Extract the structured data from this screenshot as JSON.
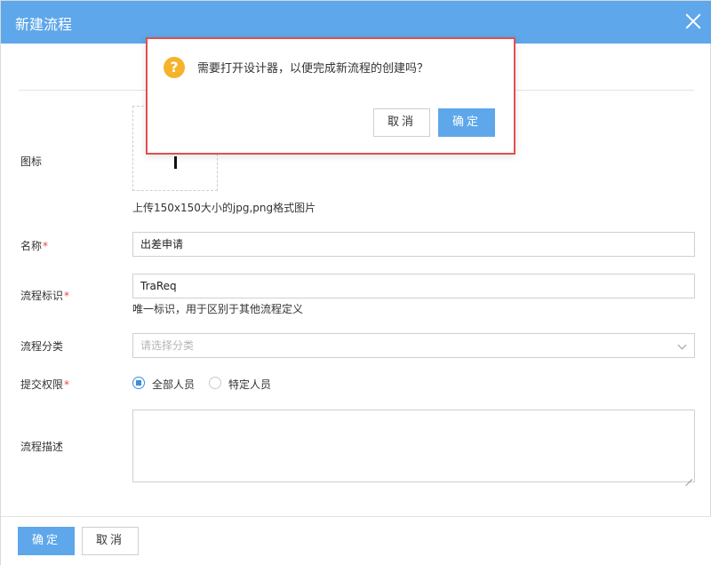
{
  "window": {
    "title": "新建流程"
  },
  "form": {
    "icon": {
      "label": "图标",
      "hint": "上传150x150大小的jpg,png格式图片"
    },
    "name": {
      "label": "名称",
      "required_mark": "*",
      "value": "出差申请"
    },
    "flow_id": {
      "label": "流程标识",
      "required_mark": "*",
      "value": "TraReq",
      "hint": "唯一标识，用于区别于其他流程定义"
    },
    "category": {
      "label": "流程分类",
      "placeholder": "请选择分类"
    },
    "permission": {
      "label": "提交权限",
      "required_mark": "*",
      "options": [
        {
          "label": "全部人员",
          "checked": true
        },
        {
          "label": "特定人员",
          "checked": false
        }
      ]
    },
    "description": {
      "label": "流程描述",
      "value": ""
    }
  },
  "footer": {
    "confirm_label": "确定",
    "cancel_label": "取消"
  },
  "confirm_dialog": {
    "icon": "question-icon",
    "icon_glyph": "?",
    "message": "需要打开设计器，以便完成新流程的创建吗？",
    "cancel_label": "取消",
    "confirm_label": "确定"
  },
  "colors": {
    "primary": "#5ea7ea",
    "required": "#e44444",
    "warning_icon": "#f5b32a",
    "highlight_border": "#e05050"
  }
}
